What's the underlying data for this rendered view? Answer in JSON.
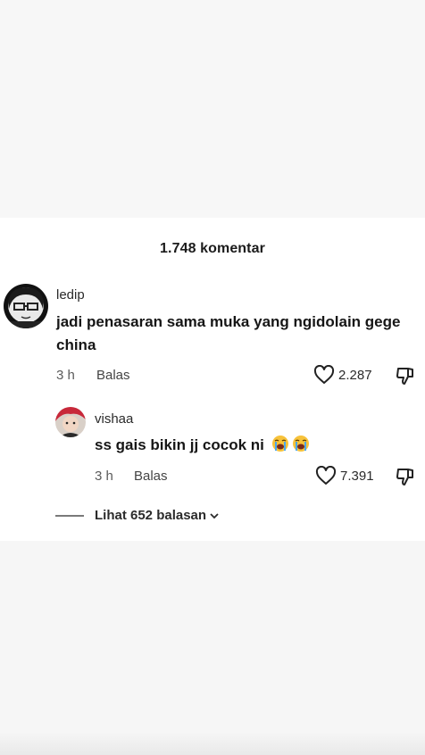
{
  "comments_header": {
    "count_label": "1.748 komentar"
  },
  "comment": {
    "username": "ledip",
    "text": "jadi penasaran sama muka yang ngidolain gege china",
    "time": "3 h",
    "reply_label": "Balas",
    "likes": "2.287"
  },
  "reply": {
    "username": "vishaa",
    "text": "ss gais bikin jj cocok ni",
    "emojis": [
      "loudly-crying-face",
      "loudly-crying-face"
    ],
    "time": "3 h",
    "reply_label": "Balas",
    "likes": "7.391"
  },
  "view_replies": {
    "label": "Lihat 652 balasan"
  },
  "colors": {
    "text": "#161616",
    "muted": "#5b5b5b",
    "panel_bg": "#ffffff",
    "page_bg": "#f7f7f7"
  }
}
